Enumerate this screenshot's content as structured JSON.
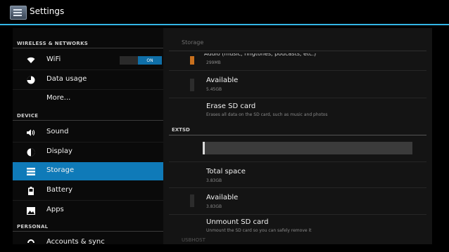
{
  "app": {
    "title": "Settings",
    "icon": "settings-app-icon",
    "accent": "#33b5e5"
  },
  "sidebar": {
    "sections": [
      {
        "header": "WIRELESS & NETWORKS"
      },
      {
        "header": "DEVICE"
      },
      {
        "header": "PERSONAL"
      }
    ],
    "items": [
      {
        "label": "WiFi",
        "icon": "wifi-icon",
        "toggle": "ON"
      },
      {
        "label": "Data usage",
        "icon": "data-usage-icon"
      },
      {
        "label": "More..."
      },
      {
        "label": "Sound",
        "icon": "sound-icon"
      },
      {
        "label": "Display",
        "icon": "display-icon"
      },
      {
        "label": "Storage",
        "icon": "storage-icon",
        "selected": true
      },
      {
        "label": "Battery",
        "icon": "battery-icon"
      },
      {
        "label": "Apps",
        "icon": "apps-icon"
      },
      {
        "label": "Accounts & sync",
        "icon": "accounts-icon"
      }
    ]
  },
  "panel": {
    "title": "Storage",
    "clipped_top": {
      "title": "Audio (music, ringtones, podcasts, etc.)",
      "subtitle": "299MB",
      "color": "#c8701e"
    },
    "available_internal": {
      "title": "Available",
      "subtitle": "5.45GB",
      "color": "#2c2c2c"
    },
    "erase": {
      "title": "Erase SD card",
      "subtitle": "Erases all data on the SD card, such as music and photos"
    },
    "extsd": {
      "header": "EXTSD",
      "usage_fraction": 0.01,
      "total": {
        "title": "Total space",
        "subtitle": "3.83GB"
      },
      "available": {
        "title": "Available",
        "subtitle": "3.83GB",
        "color": "#2c2c2c"
      },
      "unmount": {
        "title": "Unmount SD card",
        "subtitle": "Unmount the SD card so you can safely remove it"
      }
    },
    "next_section_header": "USBHOST"
  }
}
